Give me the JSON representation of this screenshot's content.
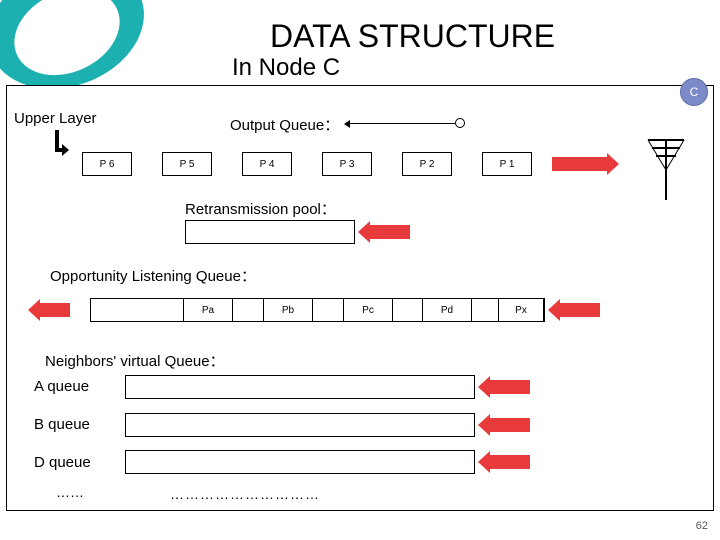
{
  "title": "DATA STRUCTURE",
  "subtitle": "In Node C",
  "node_badge": "C",
  "labels": {
    "upper": "Upper Layer",
    "output": "Output Queue：",
    "retrans": "Retransmission pool：",
    "opp": "Opportunity Listening Queue：",
    "neighbors": "Neighbors' virtual Queue：",
    "aqueue": "A queue",
    "bqueue": "B queue",
    "dqueue": "D queue",
    "ellipsis": "……",
    "dots": "…………………………"
  },
  "output_cells": [
    "P 6",
    "P 5",
    "P 4",
    "P 3",
    "P 2",
    "P 1"
  ],
  "opp_cells": [
    "Pa",
    "Pb",
    "Pc",
    "Pd",
    "Px"
  ],
  "page_number": "62"
}
